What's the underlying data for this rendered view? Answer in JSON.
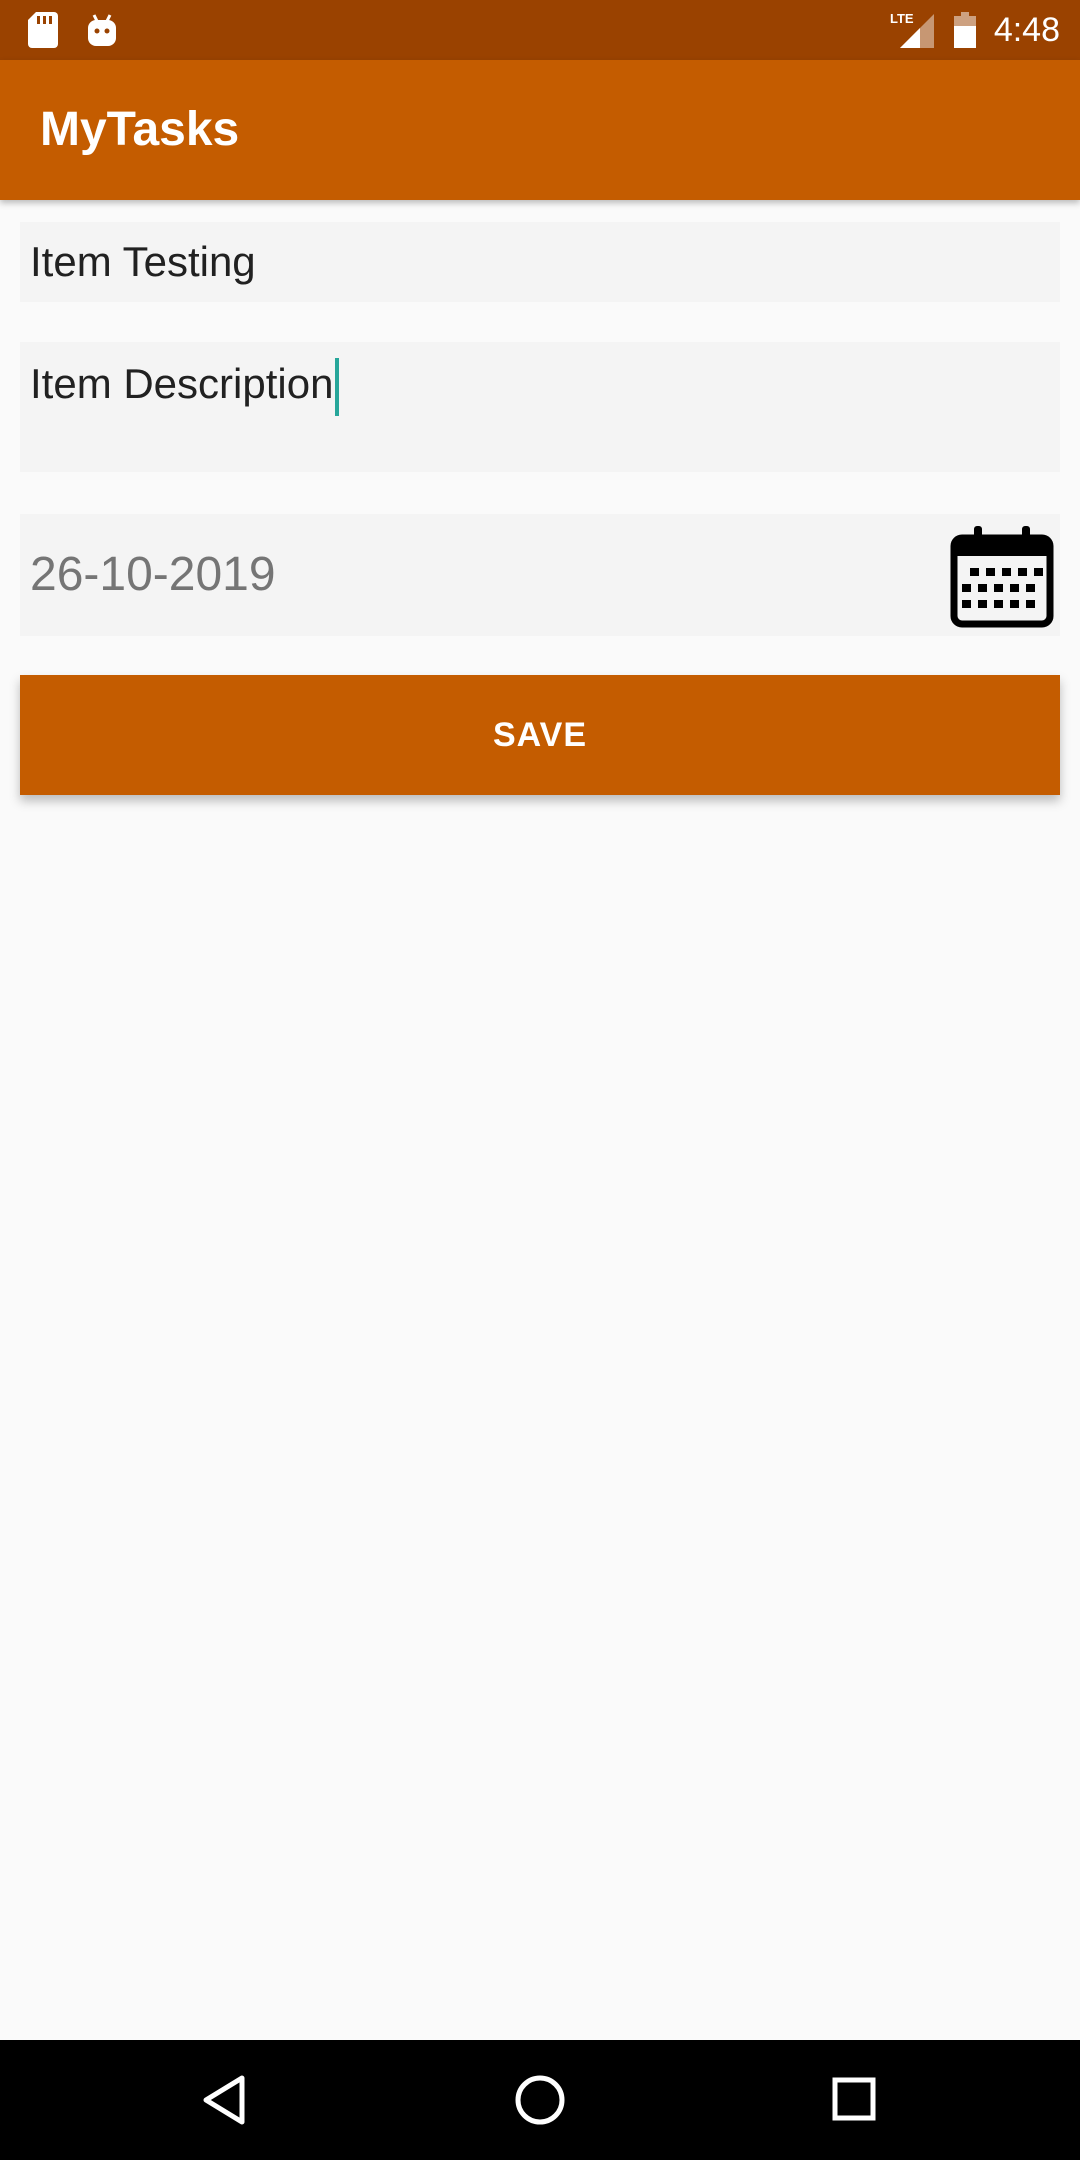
{
  "status_bar": {
    "time": "4:48",
    "network": "LTE",
    "icons": [
      "sd-card-icon",
      "android-icon",
      "lte-signal-icon",
      "battery-icon"
    ]
  },
  "app_bar": {
    "title": "MyTasks"
  },
  "form": {
    "title_value": "Item Testing",
    "description_value": "Item Description",
    "date_value": "26-10-2019",
    "date_icon": "calendar-icon",
    "save_label": "SAVE"
  },
  "nav_bar": {
    "icons": [
      "back-icon",
      "home-icon",
      "recents-icon"
    ]
  },
  "colors": {
    "status_bar": "#9a4200",
    "primary": "#c45c00",
    "background": "#fafafa",
    "cursor": "#26a69a"
  }
}
